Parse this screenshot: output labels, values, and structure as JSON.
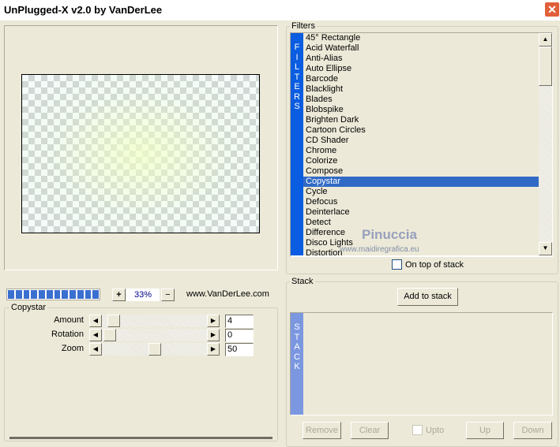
{
  "window": {
    "title": "UnPlugged-X v2.0 by VanDerLee",
    "close": "✕"
  },
  "preview": {
    "zoom_in": "+",
    "zoom": "33%",
    "zoom_out": "−",
    "website": "www.VanDerLee.com",
    "progress": 1.0
  },
  "params": {
    "group": "Copystar",
    "sliders": [
      {
        "label": "Amount",
        "value": "4",
        "fraction": 0.04
      },
      {
        "label": "Rotation",
        "value": "0",
        "fraction": 0.0
      },
      {
        "label": "Zoom",
        "value": "50",
        "fraction": 0.5
      }
    ]
  },
  "filters": {
    "group": "Filters",
    "bar_letters": [
      "F",
      "I",
      "L",
      "T",
      "E",
      "R",
      "S"
    ],
    "items": [
      "45° Rectangle",
      "Acid Waterfall",
      "Anti-Alias",
      "Auto Ellipse",
      "Barcode",
      "Blacklight",
      "Blades",
      "Blobspike",
      "Brighten Dark",
      "Cartoon Circles",
      "CD Shader",
      "Chrome",
      "Colorize",
      "Compose",
      "Copystar",
      "Cycle",
      "Defocus",
      "Deinterlace",
      "Detect",
      "Difference",
      "Disco Lights",
      "Distortion"
    ],
    "selected": "Copystar",
    "on_top_label": "On top of stack",
    "on_top_checked": false
  },
  "stack": {
    "group": "Stack",
    "add": "Add to stack",
    "bar_letters": [
      "S",
      "T",
      "A",
      "C",
      "K"
    ],
    "remove": "Remove",
    "clear": "Clear",
    "upto": "Upto",
    "up": "Up",
    "down": "Down"
  },
  "watermark": {
    "name": "Pinuccia",
    "url": "www.maidiregrafica.eu"
  }
}
